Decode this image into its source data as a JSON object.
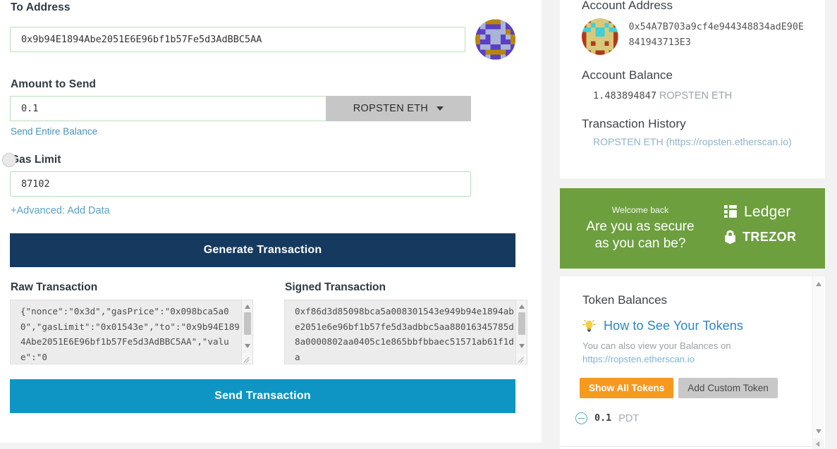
{
  "form": {
    "to_address": {
      "label": "To Address",
      "value": "0x9b94E1894Abe2051E6E96bf1b57Fe5d3AdBBC5AA",
      "identicon_name": "to-address-identicon"
    },
    "amount": {
      "label": "Amount to Send",
      "value": "0.1",
      "unit": "ROPSTEN ETH",
      "send_entire_balance": "Send Entire Balance"
    },
    "gas_limit": {
      "label": "Gas Limit",
      "value": "87102"
    },
    "advanced_link": "+Advanced: Add Data",
    "generate_button": "Generate Transaction",
    "send_button": "Send Transaction"
  },
  "transactions": {
    "raw": {
      "label": "Raw Transaction",
      "value": "{\"nonce\":\"0x3d\",\"gasPrice\":\"0x098bca5a00\",\"gasLimit\":\"0x01543e\",\"to\":\"0x9b94E1894Abe2051E6E96bf1b57Fe5d3AdBBC5AA\",\"value\":\"0"
    },
    "signed": {
      "label": "Signed Transaction",
      "value": "0xf86d3d85098bca5a008301543e949b94e1894abe2051e6e96bf1b57fe5d3adbbc5aa88016345785d8a0000802aa0405c1e865bbfbbaec51571ab61f1da"
    }
  },
  "account": {
    "address_label": "Account Address",
    "address": "0x54A7B703a9cf4e944348834adE90E841943713E3",
    "balance_label": "Account Balance",
    "balance_value": "1.483894847",
    "balance_unit": "ROPSTEN ETH",
    "history_label": "Transaction History",
    "history_link": "ROPSTEN ETH (https://ropsten.etherscan.io)"
  },
  "promo": {
    "kicker": "Welcome back",
    "headline_line1": "Are you as secure",
    "headline_line2": "as you can be?",
    "brands": [
      {
        "name": "Ledger",
        "icon": "ledger-logo-icon"
      },
      {
        "name": "TREZOR",
        "icon": "trezor-lock-icon"
      }
    ]
  },
  "tokens": {
    "title": "Token Balances",
    "howto_link": "How to See Your Tokens",
    "howto_icon": "lightbulb-icon",
    "note_text": "You can also view your Balances on",
    "note_url": "https://ropsten.etherscan.io",
    "show_all_button": "Show All Tokens",
    "add_custom_button": "Add Custom Token",
    "list": [
      {
        "amount": "0.1",
        "symbol": "PDT"
      }
    ]
  },
  "colors": {
    "generate_btn": "#163a5f",
    "send_btn": "#0e95c4",
    "promo_bg": "#6d9f3f",
    "orange_btn": "#f59a1f",
    "link_blue": "#2c87c0",
    "input_border_green": "#b9e0b9"
  }
}
